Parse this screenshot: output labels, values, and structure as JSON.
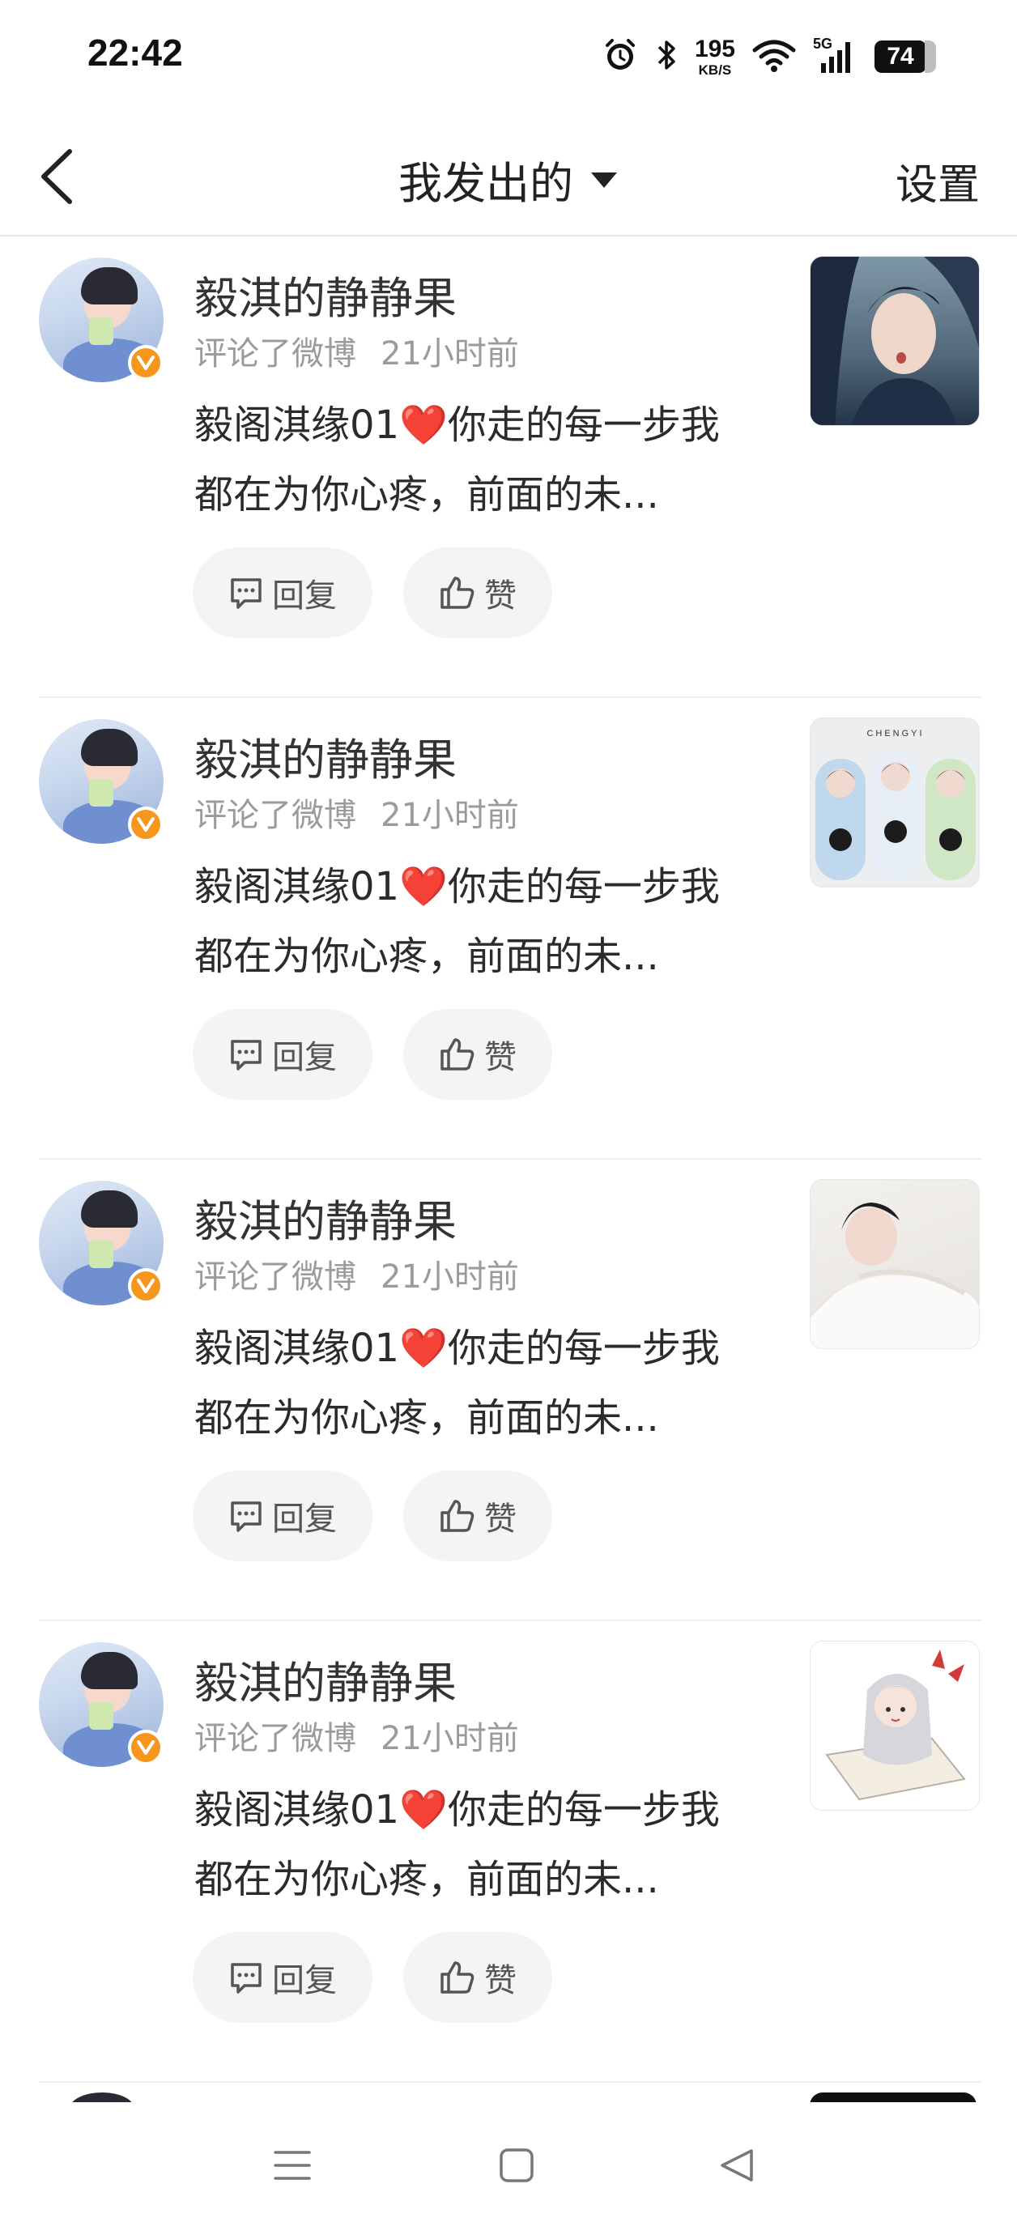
{
  "status_bar": {
    "time": "22:42",
    "net_speed_value": "195",
    "net_speed_unit": "KB/S",
    "network": "5G",
    "battery": "74",
    "icons": [
      "alarm-icon",
      "bluetooth-icon",
      "wifi-icon",
      "signal-icon"
    ]
  },
  "nav": {
    "title": "我发出的",
    "settings_label": "设置"
  },
  "cards": [
    {
      "username": "毅淇的静静果",
      "action": "评论了微博",
      "time": "21小时前",
      "text_part1": "毅阁淇缘01",
      "heart": "❤️",
      "text_part2": "你走的每一步我都在为你心疼，前面的未...",
      "reply_label": "回复",
      "like_label": "赞"
    },
    {
      "username": "毅淇的静静果",
      "action": "评论了微博",
      "time": "21小时前",
      "text_part1": "毅阁淇缘01",
      "heart": "❤️",
      "text_part2": "你走的每一步我都在为你心疼，前面的未...",
      "reply_label": "回复",
      "like_label": "赞",
      "thumb_caption": "CHENGYI"
    },
    {
      "username": "毅淇的静静果",
      "action": "评论了微博",
      "time": "21小时前",
      "text_part1": "毅阁淇缘01",
      "heart": "❤️",
      "text_part2": "你走的每一步我都在为你心疼，前面的未...",
      "reply_label": "回复",
      "like_label": "赞"
    },
    {
      "username": "毅淇的静静果",
      "action": "评论了微博",
      "time": "21小时前",
      "text_part1": "毅阁淇缘01",
      "heart": "❤️",
      "text_part2": "你走的每一步我都在为你心疼，前面的未...",
      "reply_label": "回复",
      "like_label": "赞"
    }
  ],
  "colors": {
    "verified_badge": "#f7961d",
    "heart": "#e02a2a",
    "meta_text": "#9b9b9b"
  }
}
